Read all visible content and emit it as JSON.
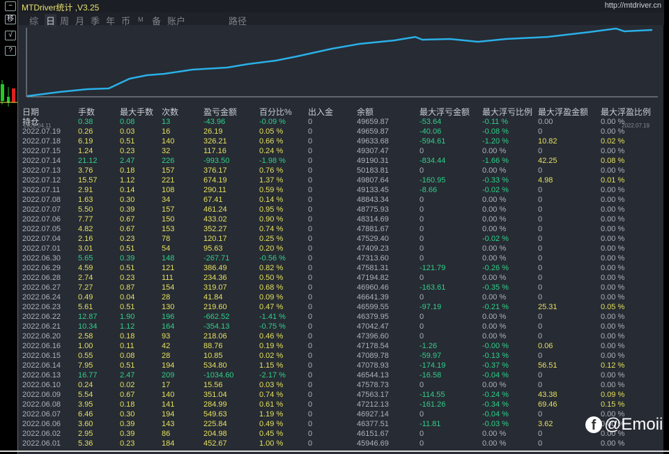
{
  "sidebar": {
    "buttons": [
      "−",
      "移",
      "√",
      "?"
    ]
  },
  "header": {
    "title": "MTDriver统计 ,V3.25",
    "url": "http://mtdriver.cn"
  },
  "tabs": [
    "综",
    "日",
    "周",
    "月",
    "季",
    "年",
    "币",
    "M",
    "备",
    "账户",
    "路径"
  ],
  "active_tab": "日",
  "chart": {
    "start_date": "2022.04.11",
    "end_date": "2022.07.19",
    "line_color": "#2ab0e8"
  },
  "table": {
    "columns": [
      "日期",
      "手数",
      "最大手数",
      "次数",
      "盈亏金额",
      "百分比%",
      "出入金",
      "余额",
      "最大浮亏金额",
      "最大浮亏比例",
      "最大浮盈金额",
      "最大浮盈比例"
    ],
    "rows": [
      [
        "持仓",
        "0.38",
        "0.08",
        "13",
        "-43.96",
        "-0.09 %",
        "0",
        "49659.87",
        "-53.64",
        "-0.11 %",
        "0.00",
        "0.00 %"
      ],
      [
        "2022.07.19",
        "0.26",
        "0.03",
        "16",
        "26.19",
        "0.05 %",
        "0",
        "49659.87",
        "-40.06",
        "-0.08 %",
        "0",
        "0.00 %"
      ],
      [
        "2022.07.18",
        "6.19",
        "0.51",
        "140",
        "326.21",
        "0.66 %",
        "0",
        "49633.68",
        "-594.61",
        "-1.20 %",
        "10.82",
        "0.02 %"
      ],
      [
        "2022.07.15",
        "1.24",
        "0.23",
        "32",
        "117.16",
        "0.24 %",
        "0",
        "49307.47",
        "0",
        "0.00 %",
        "0",
        "0.00 %"
      ],
      [
        "2022.07.14",
        "21.12",
        "2.47",
        "226",
        "-993.50",
        "-1.98 %",
        "0",
        "49190.31",
        "-834.44",
        "-1.66 %",
        "42.25",
        "0.08 %"
      ],
      [
        "2022.07.13",
        "3.76",
        "0.18",
        "157",
        "376.17",
        "0.76 %",
        "0",
        "50183.81",
        "0",
        "0.00 %",
        "0",
        "0.00 %"
      ],
      [
        "2022.07.12",
        "15.57",
        "1.12",
        "221",
        "674.19",
        "1.37 %",
        "0",
        "49807.64",
        "-160.95",
        "-0.33 %",
        "4.98",
        "0.01 %"
      ],
      [
        "2022.07.11",
        "2.91",
        "0.14",
        "108",
        "290.11",
        "0.59 %",
        "0",
        "49133.45",
        "-8.66",
        "-0.02 %",
        "0",
        "0.00 %"
      ],
      [
        "2022.07.08",
        "1.63",
        "0.30",
        "34",
        "67.41",
        "0.14 %",
        "0",
        "48843.34",
        "0",
        "0.00 %",
        "0",
        "0.00 %"
      ],
      [
        "2022.07.07",
        "5.50",
        "0.39",
        "157",
        "461.24",
        "0.95 %",
        "0",
        "48775.93",
        "0",
        "0.00 %",
        "0",
        "0.00 %"
      ],
      [
        "2022.07.06",
        "7.77",
        "0.67",
        "150",
        "433.02",
        "0.90 %",
        "0",
        "48314.69",
        "0",
        "0.00 %",
        "0",
        "0.00 %"
      ],
      [
        "2022.07.05",
        "4.82",
        "0.67",
        "153",
        "352.27",
        "0.74 %",
        "0",
        "47881.67",
        "0",
        "0.00 %",
        "0",
        "0.00 %"
      ],
      [
        "2022.07.04",
        "2.16",
        "0.23",
        "78",
        "120.17",
        "0.25 %",
        "0",
        "47529.40",
        "0",
        "-0.02 %",
        "0",
        "0.00 %"
      ],
      [
        "2022.07.01",
        "3.01",
        "0.51",
        "54",
        "95.63",
        "0.20 %",
        "0",
        "47409.23",
        "0",
        "0.00 %",
        "0",
        "0.00 %"
      ],
      [
        "2022.06.30",
        "5.65",
        "0.39",
        "148",
        "-267.71",
        "-0.56 %",
        "0",
        "47313.60",
        "0",
        "0.00 %",
        "0",
        "0.00 %"
      ],
      [
        "2022.06.29",
        "4.59",
        "0.51",
        "121",
        "386.49",
        "0.82 %",
        "0",
        "47581.31",
        "-121.79",
        "-0.26 %",
        "0",
        "0.00 %"
      ],
      [
        "2022.06.28",
        "2.74",
        "0.23",
        "111",
        "234.36",
        "0.50 %",
        "0",
        "47194.82",
        "0",
        "0.00 %",
        "0",
        "0.00 %"
      ],
      [
        "2022.06.27",
        "7.27",
        "0.87",
        "154",
        "319.07",
        "0.68 %",
        "0",
        "46960.46",
        "-163.61",
        "-0.35 %",
        "0",
        "0.00 %"
      ],
      [
        "2022.06.24",
        "0.49",
        "0.04",
        "28",
        "41.84",
        "0.09 %",
        "0",
        "46641.39",
        "0",
        "0.00 %",
        "0",
        "0.00 %"
      ],
      [
        "2022.06.23",
        "5.61",
        "0.51",
        "130",
        "219.60",
        "0.47 %",
        "0",
        "46599.55",
        "-97.19",
        "-0.21 %",
        "25.31",
        "0.05 %"
      ],
      [
        "2022.06.22",
        "12.87",
        "1.90",
        "196",
        "-662.52",
        "-1.41 %",
        "0",
        "46379.95",
        "0",
        "0.00 %",
        "0",
        "0.00 %"
      ],
      [
        "2022.06.21",
        "10.34",
        "1.12",
        "164",
        "-354.13",
        "-0.75 %",
        "0",
        "47042.47",
        "0",
        "0.00 %",
        "0",
        "0.00 %"
      ],
      [
        "2022.06.20",
        "2.58",
        "0.18",
        "93",
        "218.06",
        "0.46 %",
        "0",
        "47396.60",
        "0",
        "0.00 %",
        "0",
        "0.00 %"
      ],
      [
        "2022.06.16",
        "1.00",
        "0.11",
        "42",
        "88.76",
        "0.19 %",
        "0",
        "47178.54",
        "-1.26",
        "-0.00 %",
        "0.06",
        "0.00 %"
      ],
      [
        "2022.06.15",
        "0.55",
        "0.08",
        "28",
        "10.85",
        "0.02 %",
        "0",
        "47089.78",
        "-59.97",
        "-0.13 %",
        "0",
        "0.00 %"
      ],
      [
        "2022.06.14",
        "7.95",
        "0.51",
        "194",
        "534.80",
        "1.15 %",
        "0",
        "47078.93",
        "-174.19",
        "-0.37 %",
        "56.51",
        "0.12 %"
      ],
      [
        "2022.06.13",
        "16.77",
        "2.47",
        "209",
        "-1034.60",
        "-2.17 %",
        "0",
        "46544.13",
        "-16.58",
        "-0.04 %",
        "0",
        "0.00 %"
      ],
      [
        "2022.06.10",
        "0.24",
        "0.02",
        "17",
        "15.56",
        "0.03 %",
        "0",
        "47578.73",
        "0",
        "0.00 %",
        "0",
        "0.00 %"
      ],
      [
        "2022.06.09",
        "5.54",
        "0.67",
        "140",
        "351.04",
        "0.74 %",
        "0",
        "47563.17",
        "-114.55",
        "-0.24 %",
        "43.38",
        "0.09 %"
      ],
      [
        "2022.06.08",
        "3.95",
        "0.18",
        "141",
        "284.99",
        "0.61 %",
        "0",
        "47212.13",
        "-161.26",
        "-0.34 %",
        "69.46",
        "0.15 %"
      ],
      [
        "2022.06.07",
        "6.46",
        "0.30",
        "194",
        "549.63",
        "1.19 %",
        "0",
        "46927.14",
        "0",
        "-0.04 %",
        "0",
        "0.00 %"
      ],
      [
        "2022.06.06",
        "3.60",
        "0.39",
        "143",
        "225.84",
        "0.49 %",
        "0",
        "46377.51",
        "-11.81",
        "-0.03 %",
        "3.62",
        "0.00 %"
      ],
      [
        "2022.06.02",
        "2.95",
        "0.39",
        "86",
        "204.98",
        "0.45 %",
        "0",
        "46151.67",
        "0",
        "0.00 %",
        "0",
        "0.00 %"
      ],
      [
        "2022.06.01",
        "5.36",
        "0.23",
        "184",
        "452.67",
        "1.00 %",
        "0",
        "45946.69",
        "0",
        "0.00 %",
        "0",
        "0.00 %"
      ]
    ]
  },
  "watermark": {
    "text": "@Emoii",
    "logo": "f"
  }
}
